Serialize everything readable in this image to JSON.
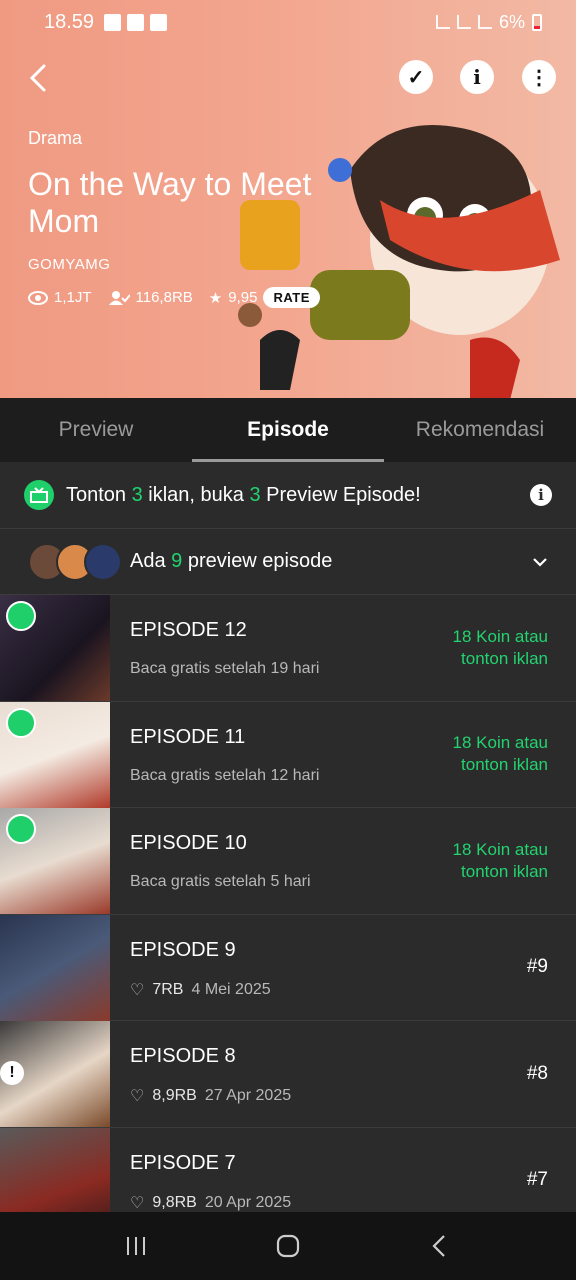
{
  "status": {
    "time": "18.59",
    "battery": "6%"
  },
  "hero": {
    "genre": "Drama",
    "title": "On the Way to Meet Mom",
    "author": "GOMYAMG",
    "views": "1,1JT",
    "subscribers": "116,8RB",
    "rating": "9,95",
    "rate_label": "RATE"
  },
  "tabs": [
    "Preview",
    "Episode",
    "Rekomendasi"
  ],
  "ad_banner": {
    "pre": "Tonton ",
    "n1": "3",
    "mid": " iklan, buka ",
    "n2": "3",
    "post": " Preview Episode!"
  },
  "preview_bar": {
    "pre": "Ada ",
    "n": "9",
    "post": " preview episode"
  },
  "episodes": [
    {
      "title": "EPISODE 12",
      "sub": "Baca gratis setelah 19 hari",
      "right1": "18 Koin atau",
      "right2": "tonton iklan"
    },
    {
      "title": "EPISODE 11",
      "sub": "Baca gratis setelah 12 hari",
      "right1": "18 Koin atau",
      "right2": "tonton iklan"
    },
    {
      "title": "EPISODE 10",
      "sub": "Baca gratis setelah 5 hari",
      "right1": "18 Koin atau",
      "right2": "tonton iklan"
    },
    {
      "title": "EPISODE 9",
      "likes": "7RB",
      "date": "4 Mei 2025",
      "num": "#9"
    },
    {
      "title": "EPISODE 8",
      "likes": "8,9RB",
      "date": "27 Apr 2025",
      "num": "#8"
    },
    {
      "title": "EPISODE 7",
      "likes": "9,8RB",
      "date": "20 Apr 2025",
      "num": "#7"
    }
  ],
  "colors": {
    "accent_green": "#22d36f",
    "background": "#2b2b2b",
    "tabbar": "#1d1d1d"
  }
}
